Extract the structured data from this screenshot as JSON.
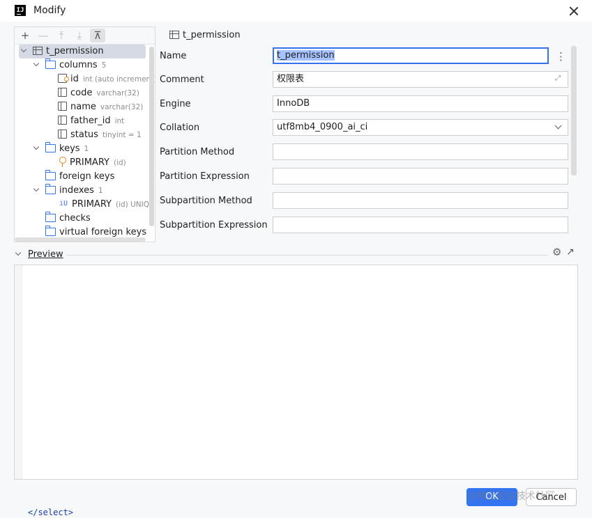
{
  "window": {
    "title": "Modify",
    "app_icon_text": "IJ"
  },
  "tree": {
    "toolbar": {
      "add": "+",
      "remove": "—",
      "move_up": "⤒",
      "move_down": "⤓",
      "pin": "⊼"
    },
    "root": {
      "label": "t_permission"
    },
    "columns": {
      "label": "columns",
      "count": "5"
    },
    "column_items": [
      {
        "name": "id",
        "type": "int (auto increment)"
      },
      {
        "name": "code",
        "type": "varchar(32)"
      },
      {
        "name": "name",
        "type": "varchar(32)"
      },
      {
        "name": "father_id",
        "type": "int"
      },
      {
        "name": "status",
        "type": "tinyint = 1"
      }
    ],
    "keys": {
      "label": "keys",
      "count": "1"
    },
    "key_item": {
      "name": "PRIMARY",
      "hint": "(id)"
    },
    "foreign_keys": {
      "label": "foreign keys"
    },
    "indexes": {
      "label": "indexes",
      "count": "1"
    },
    "index_item": {
      "name": "PRIMARY",
      "hint": "(id) UNIQUE"
    },
    "checks": {
      "label": "checks"
    },
    "virtual_foreign_keys": {
      "label": "virtual foreign keys"
    }
  },
  "details": {
    "header": "t_permission",
    "fields": {
      "name": {
        "label": "Name",
        "value": "t_permission"
      },
      "comment": {
        "label": "Comment",
        "value": "权限表"
      },
      "engine": {
        "label": "Engine",
        "value": "InnoDB"
      },
      "collation": {
        "label": "Collation",
        "value": "utf8mb4_0900_ai_ci"
      },
      "partition_method": {
        "label": "Partition Method",
        "value": ""
      },
      "partition_expression": {
        "label": "Partition Expression",
        "value": ""
      },
      "subpartition_method": {
        "label": "Subpartition Method",
        "value": ""
      },
      "subpartition_expression": {
        "label": "Subpartition Expression",
        "value": ""
      }
    }
  },
  "preview": {
    "label": "Preview"
  },
  "buttons": {
    "ok": "OK",
    "cancel": "Cancel"
  },
  "overlay": {
    "watermark": "@稀土掘金技术社区",
    "code_text": "</select>"
  }
}
